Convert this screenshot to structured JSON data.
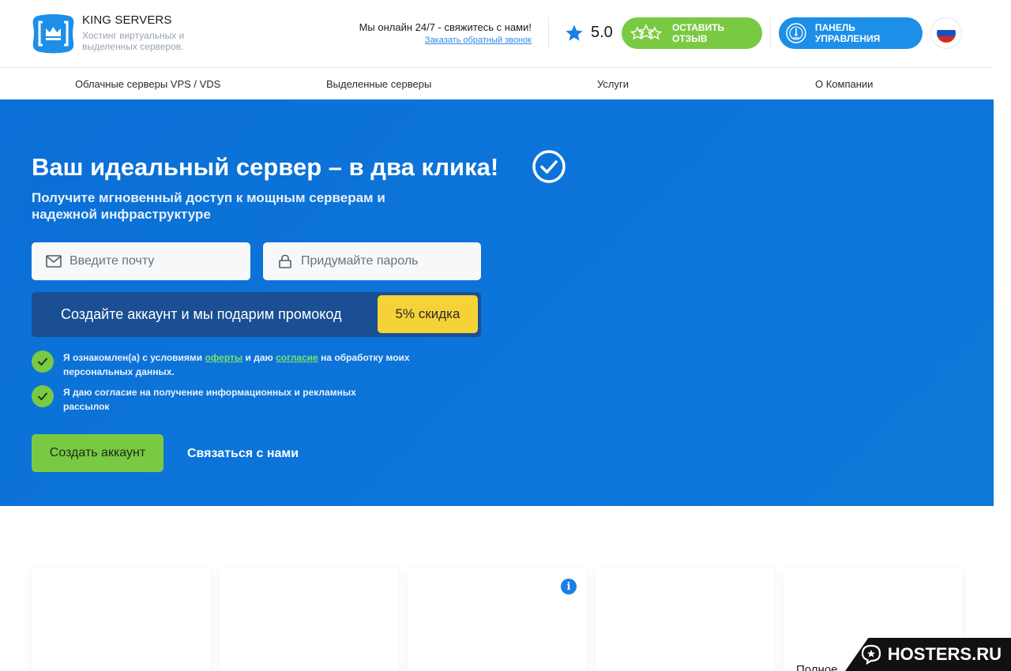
{
  "header": {
    "brand_name": "KING SERVERS",
    "brand_tagline": "Хостинг виртуальных и выделенных серверов.",
    "online_text": "Мы онлайн 24/7 - свяжитесь с нами!",
    "callback_link": "Заказать обратный звонок",
    "rating": "5.0",
    "review_button": "ОСТАВИТЬ ОТЗЫВ",
    "panel_button": "ПАНЕЛЬ УПРАВЛЕНИЯ",
    "language": "ru"
  },
  "nav": {
    "items": [
      {
        "label": "Облачные серверы VPS / VDS"
      },
      {
        "label": "Выделенные серверы"
      },
      {
        "label": "Услуги"
      },
      {
        "label": "О Компании"
      }
    ]
  },
  "hero": {
    "title": "Ваш идеальный сервер – в два клика!",
    "subtitle": "Получите мгновенный доступ к мощным серверам и надежной инфраструктуре",
    "email_placeholder": "Введите почту",
    "password_placeholder": "Придумайте пароль",
    "promo_text": "Создайте аккаунт и мы подарим промокод",
    "promo_badge": "5% скидка",
    "consent1": {
      "prefix": "Я ознакомлен(а) с условиями ",
      "link1": "оферты",
      "middle": " и даю ",
      "link2": "согласие",
      "suffix": " на обработку моих персональных данных."
    },
    "consent2": "Я даю согласие на получение информационных и рекламных рассылок",
    "create_button": "Создать аккаунт",
    "contact_link": "Связаться с нами"
  },
  "cards": {
    "partial_label": "Полное"
  },
  "watermark": "HOSTERS.RU",
  "colors": {
    "primary_blue": "#0d76da",
    "accent_green": "#7ac943",
    "promo_yellow": "#f5d237",
    "panel_blue": "#1c8fe8"
  }
}
